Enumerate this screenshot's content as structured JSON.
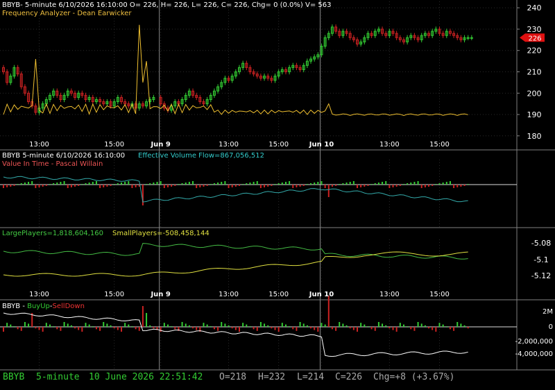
{
  "colors": {
    "background": "#000000",
    "up_candle": "#33cc33",
    "down_candle": "#cc2222",
    "price_label_bg": "#e01010",
    "axis_text": "#ffffff",
    "grid": "#2a2a2a",
    "status_text": "#33cc33"
  },
  "panel1": {
    "header": "BBYB- 5-minute 6/10/2026 16:10:00 O= 226, H= 226, L= 226, C= 226, Chg= 0 (0.0%) V= 563",
    "indicator": "Frequency Analyzer - Dean Earwicker"
  },
  "panel2": {
    "header_symbol": "BBYB 5-minute  6/10/2026 16:10:00",
    "header_flow": "Effective Volume Flow=867,056,512",
    "indicator": "Value In Time - Pascal Willain"
  },
  "panel3": {
    "large_label": "LargePlayers=1,818,604,160",
    "small_label": "SmallPlayers=-508,458,144"
  },
  "panel4": {
    "symbol": "BBYB - ",
    "buy_label": "BuyUp",
    "dash": "-",
    "sell_label": "SellDown"
  },
  "status": {
    "symbol": "BBYB",
    "interval": "5-minute",
    "datetime": "10 June 2026 22:51:42",
    "open": "O=218",
    "high": "H=232",
    "low": "L=214",
    "close": "C=226",
    "change": "Chg=+8 (+3.67%)"
  },
  "chart_data": [
    {
      "type": "candlestick",
      "title": "BBYB 5-minute",
      "x_tick_labels": [
        "13:00",
        "15:00",
        "Jun 9",
        "13:00",
        "15:00",
        "Jun 10",
        "13:00",
        "15:00"
      ],
      "y_tick_labels": [
        "240",
        "230",
        "220",
        "210",
        "200",
        "190",
        "180"
      ],
      "ylim": [
        177,
        243
      ],
      "last_price_label": "226",
      "segments": [
        {
          "name": "day1",
          "x_start": 0,
          "x_end": 43,
          "values": [
            [
              212,
              210
            ],
            [
              210,
              205
            ],
            [
              205,
              208
            ],
            [
              208,
              212
            ],
            [
              212,
              209
            ],
            [
              209,
              203
            ],
            [
              203,
              200
            ],
            [
              200,
              196
            ],
            [
              196,
              194
            ],
            [
              194,
              191
            ],
            [
              191,
              193
            ],
            [
              193,
              195
            ],
            [
              195,
              197
            ],
            [
              197,
              199
            ],
            [
              199,
              201
            ],
            [
              201,
              199
            ],
            [
              199,
              197
            ],
            [
              197,
              199
            ],
            [
              199,
              201
            ],
            [
              201,
              200
            ],
            [
              200,
              198
            ],
            [
              198,
              200
            ],
            [
              200,
              199
            ],
            [
              199,
              197
            ],
            [
              197,
              198
            ],
            [
              198,
              196
            ],
            [
              196,
              197
            ],
            [
              197,
              196
            ],
            [
              196,
              195
            ],
            [
              195,
              196
            ],
            [
              196,
              194
            ],
            [
              194,
              196
            ],
            [
              196,
              198
            ],
            [
              198,
              196
            ],
            [
              196,
              195
            ],
            [
              195,
              194
            ],
            [
              194,
              195
            ],
            [
              195,
              193
            ],
            [
              193,
              195
            ],
            [
              195,
              194
            ],
            [
              194,
              196
            ],
            [
              196,
              197
            ],
            [
              197,
              198
            ]
          ]
        },
        {
          "name": "day2",
          "x_start": 44,
          "x_end": 88,
          "values": [
            [
              198,
              195
            ],
            [
              195,
              193
            ],
            [
              193,
              192
            ],
            [
              192,
              194
            ],
            [
              194,
              196
            ],
            [
              196,
              195
            ],
            [
              195,
              197
            ],
            [
              197,
              199
            ],
            [
              199,
              201
            ],
            [
              201,
              199
            ],
            [
              199,
              198
            ],
            [
              198,
              196
            ],
            [
              196,
              195
            ],
            [
              195,
              197
            ],
            [
              197,
              199
            ],
            [
              199,
              201
            ],
            [
              201,
              203
            ],
            [
              203,
              205
            ],
            [
              205,
              207
            ],
            [
              207,
              206
            ],
            [
              206,
              208
            ],
            [
              208,
              210
            ],
            [
              210,
              212
            ],
            [
              212,
              214
            ],
            [
              214,
              212
            ],
            [
              212,
              210
            ],
            [
              210,
              209
            ],
            [
              209,
              208
            ],
            [
              208,
              207
            ],
            [
              207,
              208
            ],
            [
              208,
              207
            ],
            [
              207,
              206
            ],
            [
              206,
              208
            ],
            [
              208,
              210
            ],
            [
              210,
              211
            ],
            [
              211,
              210
            ],
            [
              210,
              212
            ],
            [
              212,
              213
            ],
            [
              213,
              212
            ],
            [
              212,
              211
            ],
            [
              211,
              213
            ],
            [
              213,
              215
            ],
            [
              215,
              216
            ],
            [
              216,
              217
            ],
            [
              217,
              218
            ]
          ]
        },
        {
          "name": "day3",
          "x_start": 89,
          "x_end": 131,
          "values": [
            [
              218,
              222
            ],
            [
              222,
              226
            ],
            [
              226,
              228
            ],
            [
              228,
              231
            ],
            [
              231,
              229
            ],
            [
              229,
              227
            ],
            [
              227,
              229
            ],
            [
              229,
              228
            ],
            [
              228,
              226
            ],
            [
              226,
              225
            ],
            [
              225,
              223
            ],
            [
              223,
              224
            ],
            [
              224,
              226
            ],
            [
              226,
              228
            ],
            [
              228,
              227
            ],
            [
              227,
              229
            ],
            [
              229,
              230
            ],
            [
              230,
              228
            ],
            [
              228,
              227
            ],
            [
              227,
              229
            ],
            [
              229,
              228
            ],
            [
              228,
              226
            ],
            [
              226,
              225
            ],
            [
              225,
              224
            ],
            [
              224,
              226
            ],
            [
              226,
              227
            ],
            [
              227,
              226
            ],
            [
              226,
              225
            ],
            [
              225,
              227
            ],
            [
              227,
              228
            ],
            [
              228,
              227
            ],
            [
              227,
              229
            ],
            [
              229,
              230
            ],
            [
              230,
              228
            ],
            [
              228,
              227
            ],
            [
              227,
              229
            ],
            [
              229,
              228
            ],
            [
              228,
              227
            ],
            [
              227,
              226
            ],
            [
              226,
              225
            ],
            [
              225,
              226
            ],
            [
              226,
              226
            ],
            [
              226,
              226
            ]
          ]
        }
      ]
    },
    {
      "type": "line",
      "title": "Frequency Analyzer - Dean Earwicker",
      "series": [
        {
          "name": "Frequency Analyzer",
          "spikes_at_x": [
            9,
            38,
            40,
            91
          ]
        }
      ]
    },
    {
      "type": "bar",
      "title": "Effective Volume Flow",
      "series": [
        {
          "name": "Effective Volume Flow",
          "values": [
            867056512
          ]
        }
      ]
    },
    {
      "type": "line",
      "y_tick_labels": [
        "-5.08",
        "-5.1",
        "-5.12"
      ],
      "series": [
        {
          "name": "LargePlayers",
          "values": [
            1818604160
          ]
        },
        {
          "name": "SmallPlayers",
          "values": [
            -508458144
          ]
        }
      ]
    },
    {
      "type": "bar",
      "title": "BuyUp-SellDown",
      "y_tick_labels": [
        "2M",
        "0",
        "-2,000,000",
        "-4,000,000"
      ]
    }
  ]
}
